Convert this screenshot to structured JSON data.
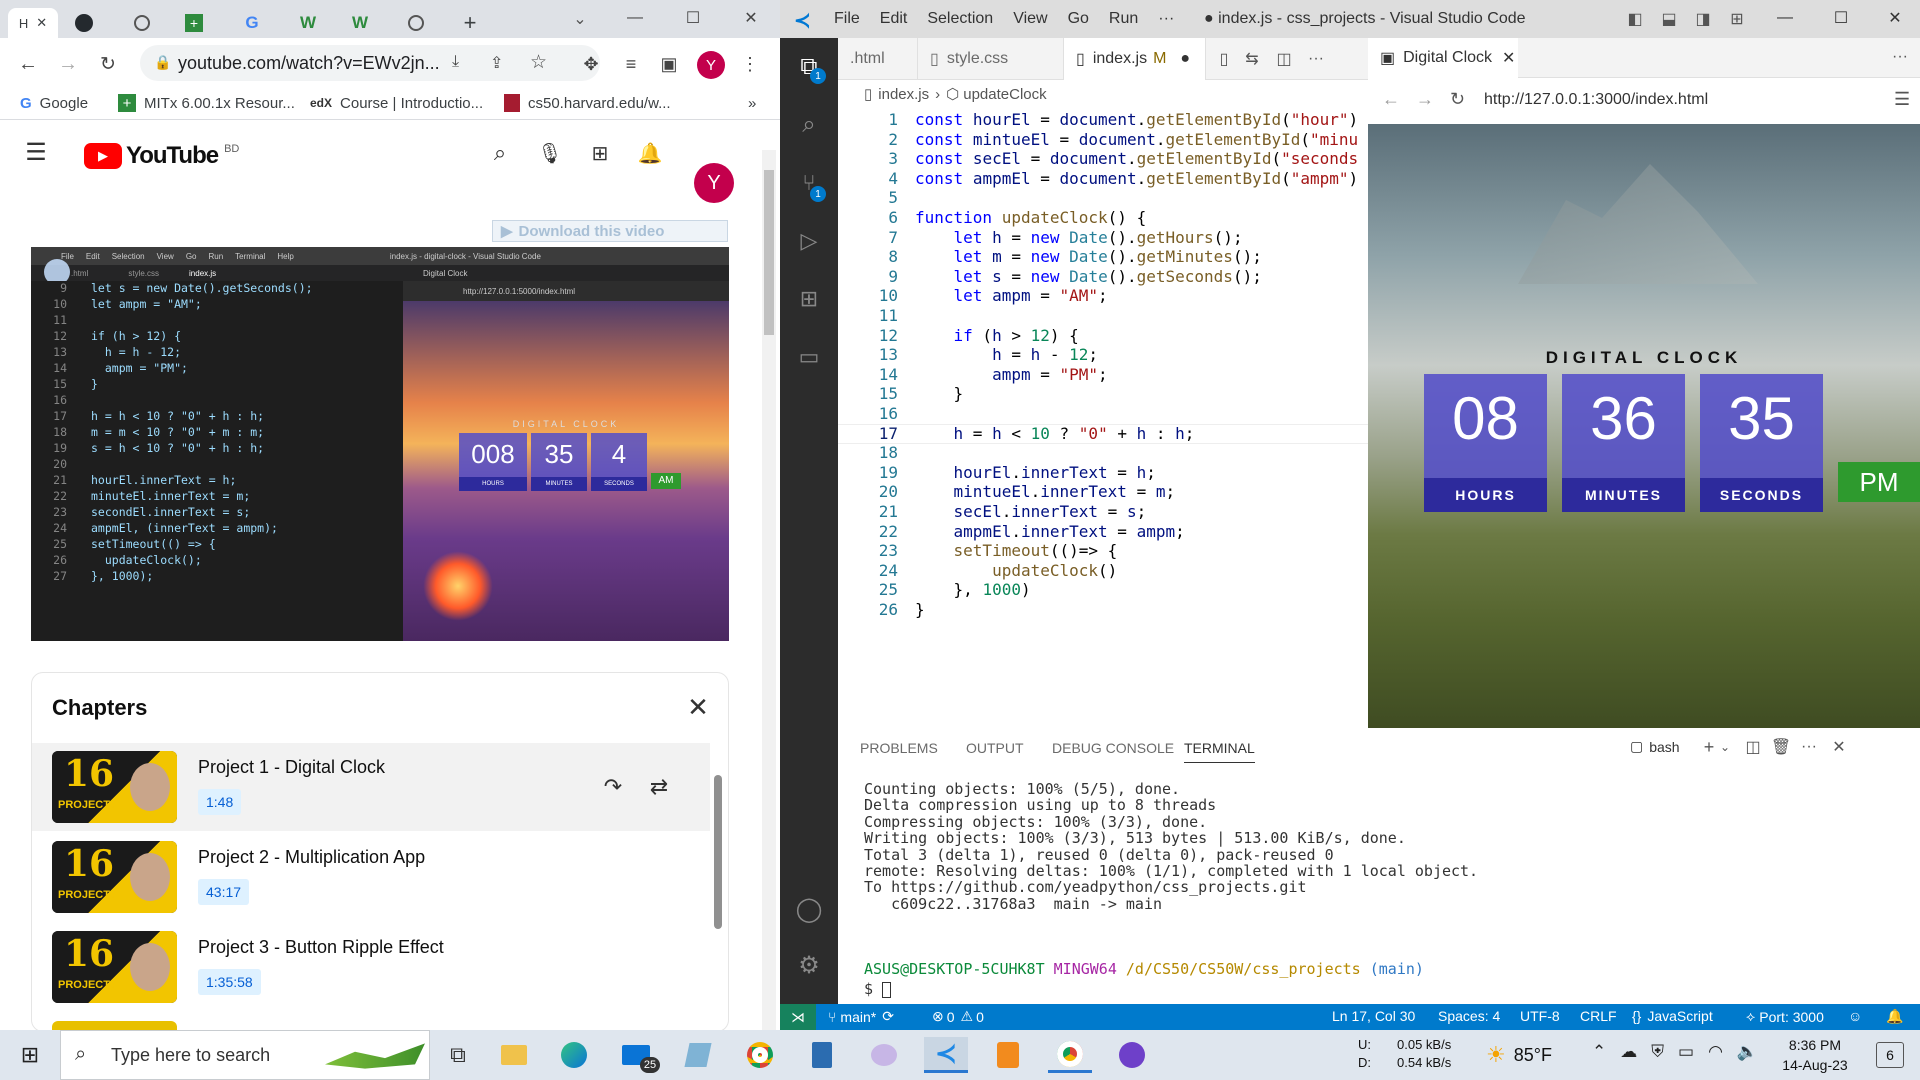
{
  "chrome": {
    "tabs": [
      "H",
      "",
      "",
      "",
      "",
      "",
      "",
      "",
      ""
    ],
    "new_tab": "+",
    "url": "youtube.com/watch?v=EWv2jn...",
    "bookmarks": [
      "Google",
      "MITx 6.00.1x Resour...",
      "Course | Introductio...",
      "cs50.harvard.edu/w..."
    ],
    "bookmarks_more": "»",
    "profile_letter": "Y"
  },
  "youtube": {
    "logo_text": "YouTube",
    "region": "BD",
    "avatar_letter": "Y",
    "download_banner": "Download this video",
    "chapters_title": "Chapters",
    "chapters": [
      {
        "title": "Project 1 - Digital Clock",
        "duration": "1:48"
      },
      {
        "title": "Project 2 - Multiplication App",
        "duration": "43:17"
      },
      {
        "title": "Project 3 - Button Ripple Effect",
        "duration": "1:35:58"
      }
    ],
    "thumb_number": "16",
    "thumb_word": "PROJECTS"
  },
  "video_frame": {
    "menu": [
      "File",
      "Edit",
      "Selection",
      "View",
      "Go",
      "Run",
      "Terminal",
      "Help"
    ],
    "title": "index.js - digital-clock - Visual Studio Code",
    "tabs": [
      ".html",
      "style.css",
      "index.js",
      "Digital Clock"
    ],
    "url": "http://127.0.0.1:5000/index.html",
    "code": [
      {
        "n": "9",
        "t": "let s = new Date().getSeconds();"
      },
      {
        "n": "10",
        "t": "let ampm = \"AM\";"
      },
      {
        "n": "11",
        "t": ""
      },
      {
        "n": "12",
        "t": "if (h > 12) {"
      },
      {
        "n": "13",
        "t": "  h = h - 12;"
      },
      {
        "n": "14",
        "t": "  ampm = \"PM\";"
      },
      {
        "n": "15",
        "t": "}"
      },
      {
        "n": "16",
        "t": ""
      },
      {
        "n": "17",
        "t": "h = h < 10 ? \"0\" + h : h;"
      },
      {
        "n": "18",
        "t": "m = m < 10 ? \"0\" + m : m;"
      },
      {
        "n": "19",
        "t": "s = h < 10 ? \"0\" + h : h;"
      },
      {
        "n": "20",
        "t": ""
      },
      {
        "n": "21",
        "t": "hourEl.innerText = h;"
      },
      {
        "n": "22",
        "t": "minuteEl.innerText = m;"
      },
      {
        "n": "23",
        "t": "secondEl.innerText = s;"
      },
      {
        "n": "24",
        "t": "ampmEl, (innerText = ampm);"
      },
      {
        "n": "25",
        "t": "setTimeout(() => {"
      },
      {
        "n": "26",
        "t": "  updateClock();"
      },
      {
        "n": "27",
        "t": "}, 1000);"
      }
    ],
    "clock_title": "DIGITAL CLOCK",
    "hours": "008",
    "minutes": "35",
    "seconds": "4",
    "hours_label": "HOURS",
    "minutes_label": "MINUTES",
    "seconds_label": "SECONDS",
    "ampm": "AM"
  },
  "vscode": {
    "menu": [
      "File",
      "Edit",
      "Selection",
      "View",
      "Go",
      "Run",
      "···"
    ],
    "title": "● index.js - css_projects - Visual Studio Code",
    "tabs": [
      ".html",
      "style.css",
      "index.js",
      "M"
    ],
    "preview_tab": "Digital Clock",
    "breadcrumb_file": "index.js",
    "breadcrumb_symbol": "updateClock",
    "preview_url": "http://127.0.0.1:3000/index.html",
    "clock": {
      "title": "DIGITAL CLOCK",
      "hours": "08",
      "minutes": "36",
      "seconds": "35",
      "hours_label": "HOURS",
      "minutes_label": "MINUTES",
      "seconds_label": "SECONDS",
      "ampm": "PM"
    },
    "panel_tabs": [
      "PROBLEMS",
      "OUTPUT",
      "DEBUG CONSOLE",
      "TERMINAL"
    ],
    "shell": "bash",
    "terminal": [
      "Counting objects: 100% (5/5), done.",
      "Delta compression using up to 8 threads",
      "Compressing objects: 100% (3/3), done.",
      "Writing objects: 100% (3/3), 513 bytes | 513.00 KiB/s, done.",
      "Total 3 (delta 1), reused 0 (delta 0), pack-reused 0",
      "remote: Resolving deltas: 100% (1/1), completed with 1 local object.",
      "To https://github.com/yeadpython/css_projects.git",
      "   c609c22..31768a3  main -> main",
      ""
    ],
    "prompt_user": "ASUS@DESKTOP-5CUHK8T",
    "prompt_env": "MINGW64",
    "prompt_path": "/d/CS50/CS50W/css_projects",
    "prompt_branch": "(main)",
    "prompt_symbol": "$",
    "status": {
      "branch": "main*",
      "errors": "0",
      "warnings": "0",
      "position": "Ln 17, Col 30",
      "spaces": "Spaces: 4",
      "encoding": "UTF-8",
      "eol": "CRLF",
      "language": "JavaScript",
      "port": "Port: 3000"
    },
    "badge_explorer": "1",
    "badge_scm": "1"
  },
  "taskbar": {
    "search_placeholder": "Type here to search",
    "mail_badge": "25",
    "net_up_label": "U:",
    "net_down_label": "D:",
    "net_up": "0.05 kB/s",
    "net_down": "0.54 kB/s",
    "temperature": "85°F",
    "time": "8:36 PM",
    "date": "14-Aug-23",
    "notif_count": "6"
  },
  "colors": {
    "youtube_red": "#ff0000",
    "vscode_blue": "#007acc",
    "clock_tile": "#544ec8",
    "ampm_green": "#2e9a2e"
  }
}
